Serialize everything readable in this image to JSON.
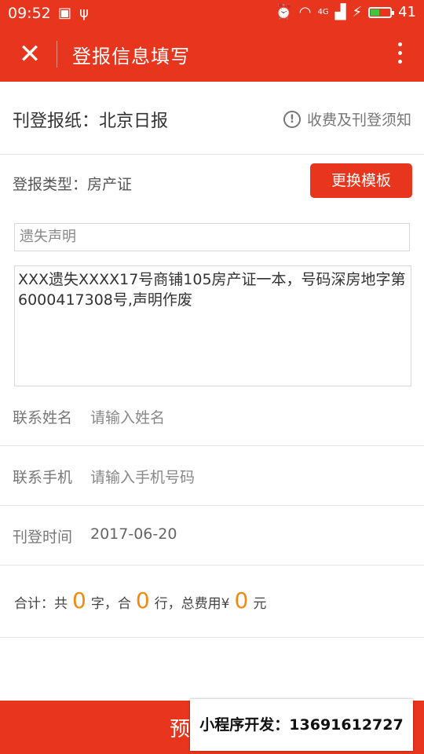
{
  "status_bar": {
    "time": "09:52",
    "battery": "41",
    "network": "4G",
    "battery_level_fraction": 0.41
  },
  "toolbar": {
    "title": "登报信息填写"
  },
  "newspaper": {
    "label": "刊登报纸：北京日报",
    "notice": "收费及刊登须知"
  },
  "ad_type": {
    "label": "登报类型：房产证",
    "change_button": "更换模板"
  },
  "ad_title": {
    "value": "遗失声明"
  },
  "ad_content": {
    "value": "XXX遗失XXXX17号商铺105房产证一本，号码深房地字第6000417308号,声明作废"
  },
  "contact_name": {
    "label": "联系姓名",
    "placeholder": "请输入姓名"
  },
  "contact_phone": {
    "label": "联系手机",
    "placeholder": "请输入手机号码"
  },
  "publish_date": {
    "label": "刊登时间",
    "value": "2017-06-20"
  },
  "total": {
    "prefix": "合计：共",
    "chars": "0",
    "mid1": "字，合",
    "lines": "0",
    "mid2": "行，总费用¥",
    "fee": "0",
    "suffix": "元"
  },
  "bottom": {
    "submit_label": "预",
    "watermark": "小程序开发：13691612727"
  },
  "colors": {
    "brand_red": "#e8361e",
    "amount_orange": "#f08a12"
  }
}
